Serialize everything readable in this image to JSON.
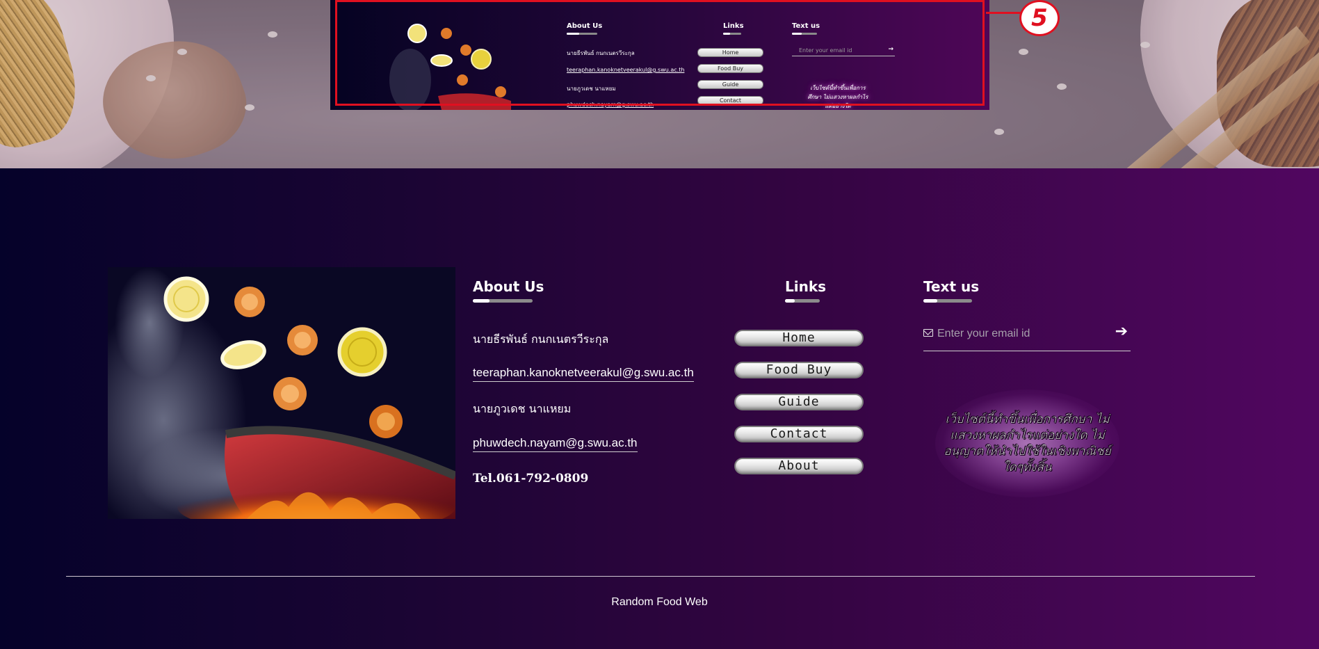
{
  "footer": {
    "about": {
      "heading": "About Us",
      "name1": "นายธีรพันธ์ กนกเนตรวีระกุล",
      "email1": "teeraphan.kanoknetveerakul@g.swu.ac.th",
      "name2": "นายภูวเดช นาแหยม",
      "email2": "phuwdech.nayam@g.swu.ac.th",
      "tel": "Tel.061-792-0809"
    },
    "links": {
      "heading": "Links",
      "items": [
        "Home",
        "Food Buy",
        "Guide",
        "Contact",
        "About"
      ]
    },
    "text_us": {
      "heading": "Text us",
      "placeholder": "Enter your email id",
      "notice": "เว็บไซต์นี้ทำขึ้นเพื่อการศึกษา ไม่แสวงหาผลกำไรแต่อย่างใด ไม่อนุญาตให้นำไปใช้ในเชิงพาณิชย์ใดๆทั้งสิ้น"
    },
    "site_name": "Random Food Web"
  },
  "preview": {
    "callout_number": "5",
    "about_heading": "About Us",
    "links_heading": "Links",
    "text_heading": "Text us",
    "name1": "นายธีรพันธ์ กนกเนตรวีระกุล",
    "email1": "teeraphan.kanoknetveerakul@g.swu.ac.th",
    "name2": "นายภูวเดช นาแหยม",
    "email2": "phuwdech.nayam@g.swu.ac.th",
    "links": [
      "Home",
      "Food Buy",
      "Guide",
      "Contact"
    ],
    "placeholder": "Enter your email id",
    "notice": "เว็บไซต์นี้ทำขึ้นเพื่อการศึกษา ไม่แสวงหาผลกำไรแต่อย่างใด"
  },
  "colors": {
    "gradient_start": "#05022a",
    "gradient_end": "#510660",
    "callout_red": "#e01020"
  },
  "icons": {
    "email": "envelope-icon",
    "submit": "arrow-right-icon"
  }
}
